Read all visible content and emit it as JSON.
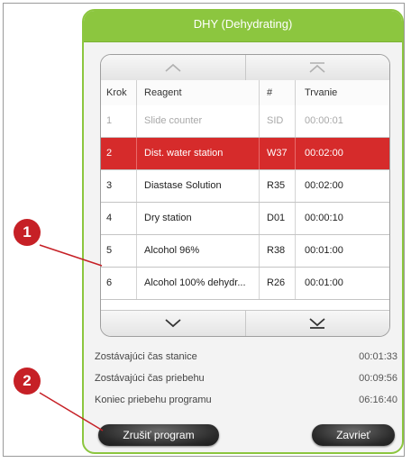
{
  "dialog": {
    "title": "DHY (Dehydrating)"
  },
  "table": {
    "columns": {
      "krok": "Krok",
      "reagent": "Reagent",
      "num": "#",
      "trvanie": "Trvanie"
    },
    "rows": [
      {
        "krok": "1",
        "reagent": "Slide counter",
        "num": "SID",
        "trvanie": "00:00:01",
        "state": "inactive"
      },
      {
        "krok": "2",
        "reagent": "Dist. water station",
        "num": "W37",
        "trvanie": "00:02:00",
        "state": "selected"
      },
      {
        "krok": "3",
        "reagent": "Diastase Solution",
        "num": "R35",
        "trvanie": "00:02:00",
        "state": "normal"
      },
      {
        "krok": "4",
        "reagent": "Dry station",
        "num": "D01",
        "trvanie": "00:00:10",
        "state": "normal"
      },
      {
        "krok": "5",
        "reagent": "Alcohol 96%",
        "num": "R38",
        "trvanie": "00:01:00",
        "state": "normal"
      },
      {
        "krok": "6",
        "reagent": "Alcohol 100% dehydr...",
        "num": "R26",
        "trvanie": "00:01:00",
        "state": "normal"
      }
    ],
    "scroll_icons": [
      "chevron-up-icon",
      "scroll-to-top-icon",
      "chevron-down-icon",
      "scroll-to-bottom-icon"
    ]
  },
  "info": {
    "station_remaining_label": "Zostávajúci čas stanice",
    "station_remaining_value": "00:01:33",
    "run_remaining_label": "Zostávajúci čas priebehu",
    "run_remaining_value": "00:09:56",
    "program_end_label": "Koniec priebehu programu",
    "program_end_value": "06:16:40"
  },
  "buttons": {
    "abort": "Zrušiť program",
    "close": "Zavrieť"
  },
  "callouts": {
    "one": "1",
    "two": "2"
  },
  "colors": {
    "accent": "#8cc63f",
    "selected_row": "#d62b2b",
    "callout": "#c62026"
  }
}
